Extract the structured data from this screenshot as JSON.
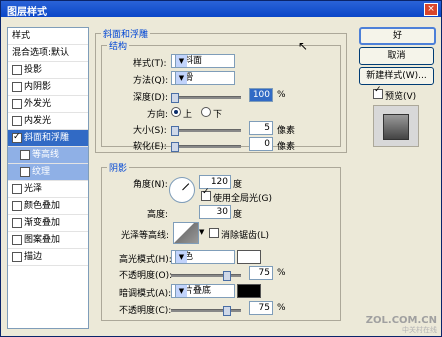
{
  "window": {
    "title": "图层样式",
    "close": "×"
  },
  "left": {
    "items": [
      {
        "label": "样式",
        "header": true
      },
      {
        "label": "混合选项:默认",
        "header": true
      },
      {
        "label": "投影",
        "checked": false
      },
      {
        "label": "内阴影",
        "checked": false
      },
      {
        "label": "外发光",
        "checked": false
      },
      {
        "label": "内发光",
        "checked": false
      },
      {
        "label": "斜面和浮雕",
        "checked": true,
        "selected": true
      },
      {
        "label": "等高线",
        "checked": false,
        "sub": true
      },
      {
        "label": "纹理",
        "checked": false,
        "sub": true
      },
      {
        "label": "光泽",
        "checked": false
      },
      {
        "label": "颜色叠加",
        "checked": false
      },
      {
        "label": "渐变叠加",
        "checked": false
      },
      {
        "label": "图案叠加",
        "checked": false
      },
      {
        "label": "描边",
        "checked": false
      }
    ]
  },
  "bevel": {
    "section_title": "斜面和浮雕",
    "structure_title": "结构",
    "style_label": "样式(T):",
    "style_value": "内斜面",
    "method_label": "方法(Q):",
    "method_value": "平滑",
    "depth_label": "深度(D):",
    "depth_value": "100",
    "depth_unit": "%",
    "depth_level": 100,
    "direction_label": "方向:",
    "dir_up": "上",
    "dir_down": "下",
    "size_label": "大小(S):",
    "size_value": "5",
    "size_unit": "像素",
    "soften_label": "软化(E):",
    "soften_value": "0",
    "soften_unit": "像素"
  },
  "shading": {
    "title": "阴影",
    "angle_label": "角度(N):",
    "angle_value": "120",
    "angle_unit": "度",
    "global_light_label": "使用全局光(G)",
    "altitude_label": "高度:",
    "altitude_value": "30",
    "altitude_unit": "度",
    "gloss_label": "光泽等高线:",
    "antialias_label": "消除锯齿(L)",
    "highlight_label": "高光模式(H):",
    "highlight_value": "滤色",
    "highlight_color": "#ffffff",
    "hl_opacity_label": "不透明度(O):",
    "hl_opacity_value": "75",
    "hl_opacity_unit": "%",
    "shadow_label": "暗调模式(A):",
    "shadow_value": "正片叠底",
    "shadow_color": "#000000",
    "sh_opacity_label": "不透明度(C):",
    "sh_opacity_value": "75",
    "sh_opacity_unit": "%"
  },
  "buttons": {
    "ok": "好",
    "cancel": "取消",
    "new_style": "新建样式(W)...",
    "preview": "预览(V)"
  },
  "watermark": {
    "main": "ZOL.COM.CN",
    "sub": "中关村在线"
  }
}
